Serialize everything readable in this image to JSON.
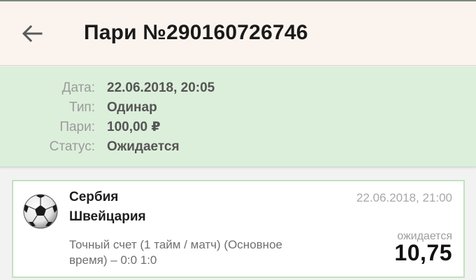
{
  "header": {
    "title": "Пари №290160726746"
  },
  "details": [
    {
      "label": "Дата:",
      "value": "22.06.2018, 20:05"
    },
    {
      "label": "Тип:",
      "value": "Одинар"
    },
    {
      "label": "Пари:",
      "value": "100,00 ₽"
    },
    {
      "label": "Статус:",
      "value": "Ожидается"
    }
  ],
  "event": {
    "sport_icon": "soccer-ball-icon",
    "team_home": "Сербия",
    "team_away": "Швейцария",
    "date": "22.06.2018, 21:00",
    "market": "Точный счет (1 тайм / матч) (Основное время) – 0:0 1:0",
    "status": "ожидается",
    "odds": "10,75"
  },
  "colors": {
    "app_bar": "#fbf4ee",
    "info_panel": "#dcefdb",
    "card_border": "#bfe3bd"
  }
}
